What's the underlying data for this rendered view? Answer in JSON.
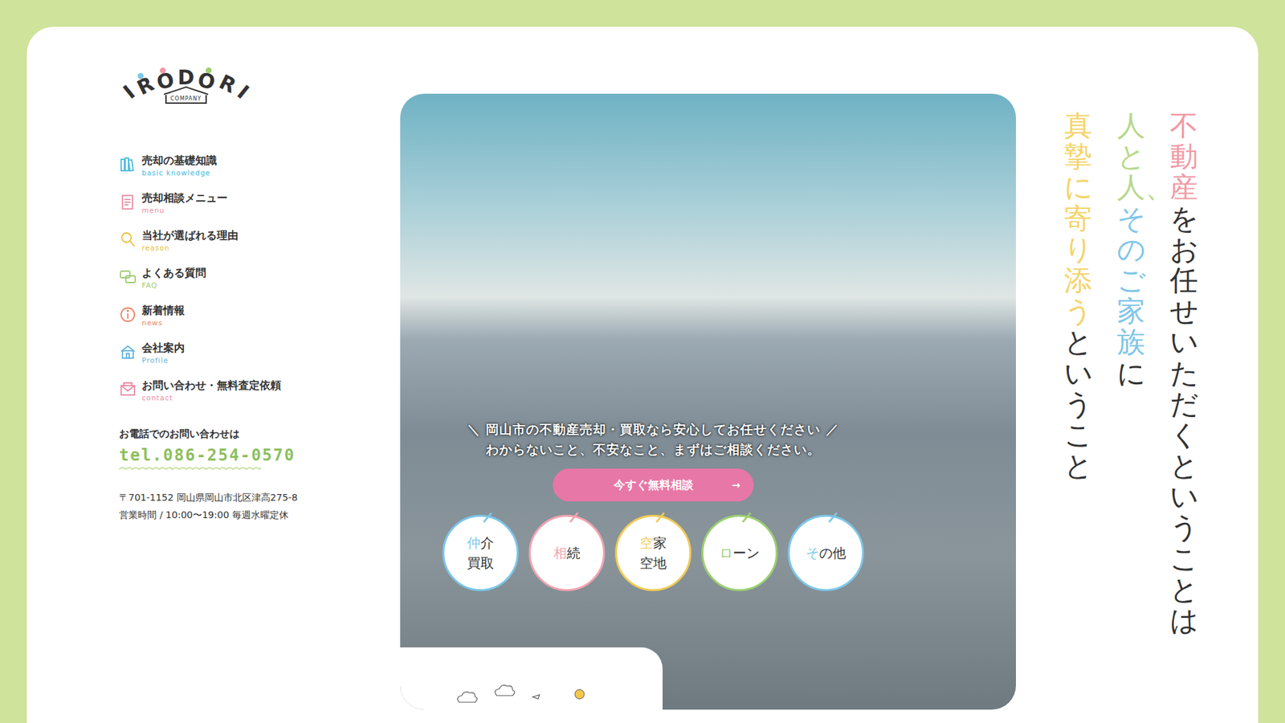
{
  "logo": {
    "name": "IRODORI",
    "sub": "COMPANY"
  },
  "nav": [
    {
      "label": "売却の基礎知識",
      "sub": "basic knowledge",
      "color": "#43b9e0",
      "kind": "books"
    },
    {
      "label": "売却相談メニュー",
      "sub": "menu",
      "color": "#e98fa3",
      "kind": "memo"
    },
    {
      "label": "当社が選ばれる理由",
      "sub": "reason",
      "color": "#e9bd35",
      "kind": "search"
    },
    {
      "label": "よくある質問",
      "sub": "FAQ",
      "color": "#9fca6f",
      "kind": "chat"
    },
    {
      "label": "新着情報",
      "sub": "news",
      "color": "#e88466",
      "kind": "info"
    },
    {
      "label": "会社案内",
      "sub": "Profile",
      "color": "#5fb2e0",
      "kind": "house"
    },
    {
      "label": "お問い合わせ・無料査定依頼",
      "sub": "contact",
      "color": "#e98aa3",
      "kind": "mail"
    }
  ],
  "contact": {
    "lead": "お電話でのお問い合わせは",
    "tel": "tel.086-254-0570",
    "address": "〒701-1152 岡山県岡山市北区津高275-8",
    "hours": "営業時間 / 10:00〜19:00 毎週水曜定休"
  },
  "hero": {
    "headline": "＼ 岡山市の不動産売却・買取なら安心してお任せください ／",
    "subline": "わからないこと、不安なこと、まずはご相談ください。",
    "cta": {
      "label": "今すぐ無料相談",
      "arrow": "→"
    },
    "categories": [
      {
        "head": "仲",
        "tail": "介",
        "line2": "買取",
        "color": "#7cc7e8"
      },
      {
        "head": "相",
        "tail": "続",
        "line2": "",
        "color": "#f2a3b0"
      },
      {
        "head": "空",
        "tail": "家",
        "line2": "空地",
        "color": "#f1cc55"
      },
      {
        "head": "ロ",
        "tail": "ーン",
        "line2": "",
        "color": "#9cd071"
      },
      {
        "head": "そ",
        "tail": "の他",
        "line2": "",
        "color": "#7cc7e8"
      }
    ]
  },
  "tagline": [
    {
      "segments": [
        {
          "text": "不動産",
          "color": "#f09aa6"
        },
        {
          "text": "をお任せいただくということは",
          "color": "#333333"
        }
      ]
    },
    {
      "segments": [
        {
          "text": "人と人、",
          "color": "#b7d88a"
        },
        {
          "text": "そのご家族",
          "color": "#7fc6e8"
        },
        {
          "text": "に",
          "color": "#333333"
        }
      ]
    },
    {
      "segments": [
        {
          "text": "真摯に寄り添う",
          "color": "#f4d46a"
        },
        {
          "text": "ということ",
          "color": "#333333"
        }
      ]
    }
  ]
}
